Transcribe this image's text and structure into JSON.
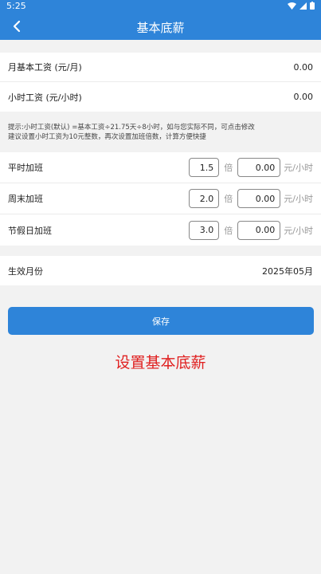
{
  "status": {
    "time": "5:25"
  },
  "header": {
    "title": "基本底薪"
  },
  "base": [
    {
      "label": "月基本工资 (元/月)",
      "value": "0.00"
    },
    {
      "label": "小时工资 (元/小时)",
      "value": "0.00"
    }
  ],
  "hint": {
    "line1": "提示:小时工资(默认) =基本工资÷21.75天÷8小时，如与您实际不同，可点击修改",
    "line2": "建议设置小时工资为10元整数，再次设置加班倍数，计算方便快捷"
  },
  "overtime": [
    {
      "label": "平时加班",
      "multiplier": "1.5",
      "multiplier_unit": "倍",
      "rate": "0.00",
      "rate_unit": "元/小时"
    },
    {
      "label": "周末加班",
      "multiplier": "2.0",
      "multiplier_unit": "倍",
      "rate": "0.00",
      "rate_unit": "元/小时"
    },
    {
      "label": "节假日加班",
      "multiplier": "3.0",
      "multiplier_unit": "倍",
      "rate": "0.00",
      "rate_unit": "元/小时"
    }
  ],
  "effective": {
    "label": "生效月份",
    "value": "2025年05月"
  },
  "save_label": "保存",
  "caption": "设置基本底薪",
  "colors": {
    "primary": "#2e84d9",
    "caption": "#e02020"
  }
}
